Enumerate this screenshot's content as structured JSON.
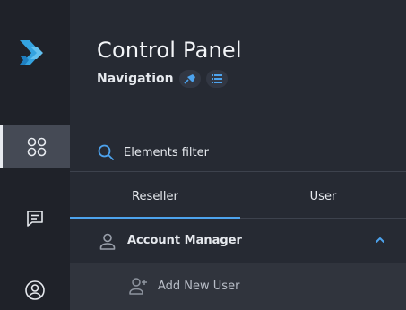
{
  "header": {
    "title": "Control Panel",
    "subtitle": "Navigation"
  },
  "rail": {
    "items": [
      {
        "icon": "grid-icon",
        "active": true
      },
      {
        "icon": "chat-icon",
        "active": false
      },
      {
        "icon": "user-circle-icon",
        "active": false
      }
    ]
  },
  "search": {
    "placeholder": "Elements filter",
    "value": ""
  },
  "tabs": [
    {
      "label": "Reseller",
      "active": true
    },
    {
      "label": "User",
      "active": false
    }
  ],
  "menu": {
    "section_label": "Account Manager",
    "expanded": true,
    "items": [
      {
        "label": "Add New User",
        "icon": "add-user-icon"
      }
    ]
  },
  "colors": {
    "accent": "#4da3ee",
    "background": "#262a33",
    "rail": "#1f2229"
  }
}
